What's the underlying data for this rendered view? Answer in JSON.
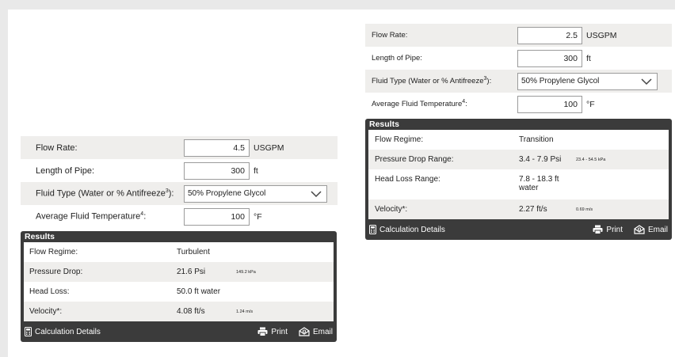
{
  "left": {
    "inputs": {
      "flow_rate_label": "Flow Rate:",
      "flow_rate_value": "4.5",
      "flow_rate_unit": "USGPM",
      "pipe_length_label": "Length of Pipe:",
      "pipe_length_value": "300",
      "pipe_length_unit": "ft",
      "fluid_type_label": "Fluid Type (Water or % Antifreeze",
      "fluid_type_sup": "3",
      "fluid_type_suffix": "):",
      "fluid_type_value": "50% Propylene Glycol",
      "temp_label": "Average Fluid Temperature",
      "temp_sup": "4",
      "temp_suffix": ":",
      "temp_value": "100",
      "temp_unit": "°F"
    },
    "results": {
      "heading": "Results",
      "rows": [
        {
          "label": "Flow Regime:",
          "value": "Turbulent",
          "sub": ""
        },
        {
          "label": "Pressure Drop:",
          "value": "21.6 Psi",
          "sub": "149.2 kPa"
        },
        {
          "label": "Head Loss:",
          "value": "50.0 ft water",
          "sub": ""
        },
        {
          "label": "Velocity*:",
          "value": "4.08 ft/s",
          "sub": "1.24 m/s"
        }
      ],
      "details_label": "Calculation Details",
      "print_label": "Print",
      "email_label": "Email"
    }
  },
  "right": {
    "inputs": {
      "flow_rate_label": "Flow Rate:",
      "flow_rate_value": "2.5",
      "flow_rate_unit": "USGPM",
      "pipe_length_label": "Length of Pipe:",
      "pipe_length_value": "300",
      "pipe_length_unit": "ft",
      "fluid_type_label": "Fluid Type (Water or % Antifreeze",
      "fluid_type_sup": "3",
      "fluid_type_suffix": "):",
      "fluid_type_value": "50% Propylene Glycol",
      "temp_label": "Average Fluid Temperature",
      "temp_sup": "4",
      "temp_suffix": ":",
      "temp_value": "100",
      "temp_unit": "°F"
    },
    "results": {
      "heading": "Results",
      "rows": [
        {
          "label": "Flow Regime:",
          "value": "Transition",
          "sub": ""
        },
        {
          "label": "Pressure Drop Range:",
          "value": "3.4 - 7.9 Psi",
          "sub": "23.4 - 54.5 kPa"
        },
        {
          "label": "Head Loss Range:",
          "value": "7.8 - 18.3 ft",
          "value2": "water",
          "sub": ""
        },
        {
          "label": "Velocity*:",
          "value": "2.27 ft/s",
          "sub": "0.69 m/s"
        }
      ],
      "details_label": "Calculation Details",
      "print_label": "Print",
      "email_label": "Email"
    }
  },
  "icons": {
    "calculator": "calculator-icon",
    "printer": "printer-icon",
    "email": "email-icon",
    "chevron": "chevron-down-icon"
  },
  "colors": {
    "panel_dark": "#3b3b3b",
    "row_shade": "#efeeec",
    "background": "#e9e9e9"
  }
}
